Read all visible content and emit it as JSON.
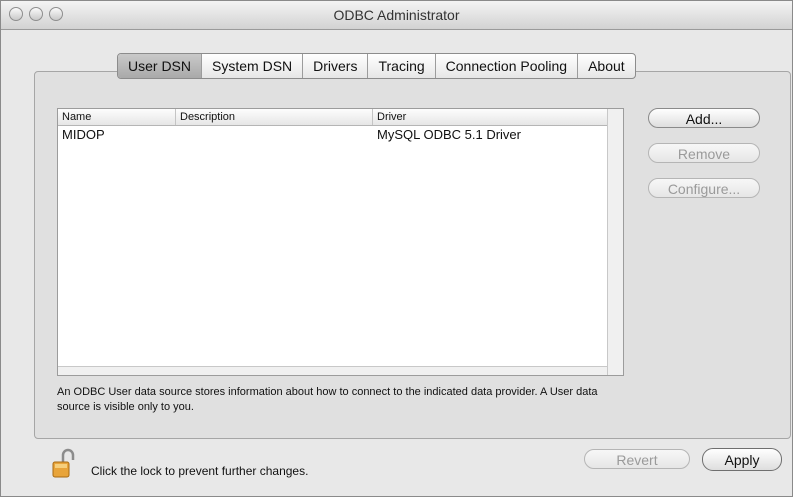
{
  "window": {
    "title": "ODBC Administrator"
  },
  "tabs": [
    {
      "label": "User DSN",
      "active": true
    },
    {
      "label": "System DSN",
      "active": false
    },
    {
      "label": "Drivers",
      "active": false
    },
    {
      "label": "Tracing",
      "active": false
    },
    {
      "label": "Connection Pooling",
      "active": false
    },
    {
      "label": "About",
      "active": false
    }
  ],
  "table": {
    "columns": [
      "Name",
      "Description",
      "Driver"
    ],
    "rows": [
      {
        "name": "MIDOP",
        "description": "",
        "driver": "MySQL ODBC 5.1 Driver"
      }
    ]
  },
  "buttons": {
    "add": "Add...",
    "remove": "Remove",
    "configure": "Configure...",
    "revert": "Revert",
    "apply": "Apply"
  },
  "description_text": "An ODBC User data source stores information about how to connect to the indicated data provider. A User data source is visible only to you.",
  "lock_message": "Click the lock to prevent further changes."
}
